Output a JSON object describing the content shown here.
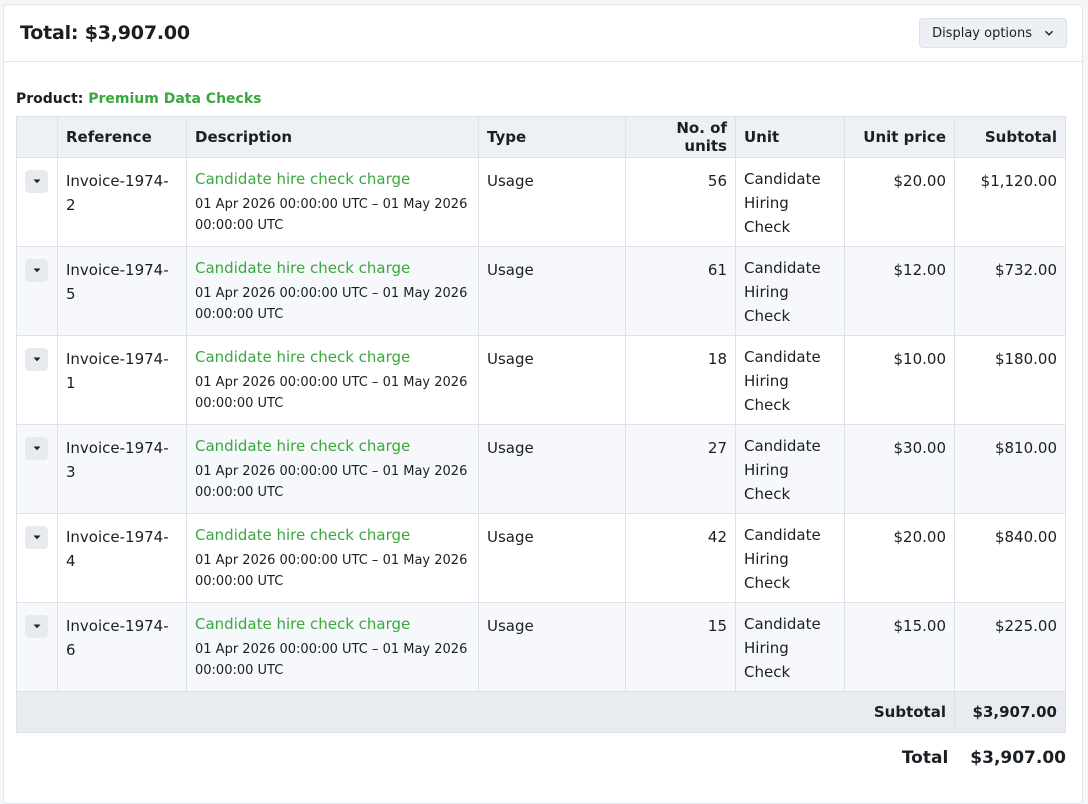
{
  "header": {
    "title": "Total: $3,907.00",
    "display_options_label": "Display options"
  },
  "product": {
    "label": "Product:",
    "name": "Premium Data Checks"
  },
  "table": {
    "columns": [
      "",
      "Reference",
      "Description",
      "Type",
      "No. of units",
      "Unit",
      "Unit price",
      "Subtotal"
    ],
    "rows": [
      {
        "reference": "Invoice-1974-2",
        "description": "Candidate hire check charge",
        "period": "01 Apr 2026 00:00:00 UTC – 01 May 2026 00:00:00 UTC",
        "type": "Usage",
        "units": "56",
        "unit": "Candidate Hiring Check",
        "unit_price": "$20.00",
        "subtotal": "$1,120.00"
      },
      {
        "reference": "Invoice-1974-5",
        "description": "Candidate hire check charge",
        "period": "01 Apr 2026 00:00:00 UTC – 01 May 2026 00:00:00 UTC",
        "type": "Usage",
        "units": "61",
        "unit": "Candidate Hiring Check",
        "unit_price": "$12.00",
        "subtotal": "$732.00"
      },
      {
        "reference": "Invoice-1974-1",
        "description": "Candidate hire check charge",
        "period": "01 Apr 2026 00:00:00 UTC – 01 May 2026 00:00:00 UTC",
        "type": "Usage",
        "units": "18",
        "unit": "Candidate Hiring Check",
        "unit_price": "$10.00",
        "subtotal": "$180.00"
      },
      {
        "reference": "Invoice-1974-3",
        "description": "Candidate hire check charge",
        "period": "01 Apr 2026 00:00:00 UTC – 01 May 2026 00:00:00 UTC",
        "type": "Usage",
        "units": "27",
        "unit": "Candidate Hiring Check",
        "unit_price": "$30.00",
        "subtotal": "$810.00"
      },
      {
        "reference": "Invoice-1974-4",
        "description": "Candidate hire check charge",
        "period": "01 Apr 2026 00:00:00 UTC – 01 May 2026 00:00:00 UTC",
        "type": "Usage",
        "units": "42",
        "unit": "Candidate Hiring Check",
        "unit_price": "$20.00",
        "subtotal": "$840.00"
      },
      {
        "reference": "Invoice-1974-6",
        "description": "Candidate hire check charge",
        "period": "01 Apr 2026 00:00:00 UTC – 01 May 2026 00:00:00 UTC",
        "type": "Usage",
        "units": "15",
        "unit": "Candidate Hiring Check",
        "unit_price": "$15.00",
        "subtotal": "$225.00"
      }
    ],
    "subtotal_label": "Subtotal",
    "subtotal_value": "$3,907.00"
  },
  "footer": {
    "total_label": "Total",
    "total_value": "$3,907.00"
  },
  "icons": {
    "expander": "caret-down-icon",
    "dropdown": "chevron-down-icon"
  },
  "colors": {
    "accent_green": "#3aa83f"
  }
}
